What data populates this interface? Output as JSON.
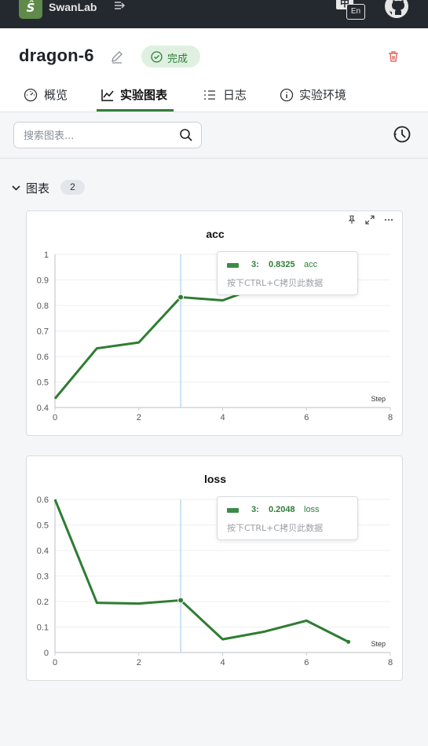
{
  "topbar": {
    "logo_glyph": "Ŝ",
    "brand": "SwanLab",
    "lang_zh": "中",
    "lang_en": "En"
  },
  "header": {
    "title": "dragon-6",
    "status": "完成",
    "tabs": [
      {
        "label": "概览",
        "icon": "gauge-icon"
      },
      {
        "label": "实验图表",
        "icon": "line-chart-icon",
        "active": true
      },
      {
        "label": "日志",
        "icon": "list-icon"
      },
      {
        "label": "实验环境",
        "icon": "info-icon"
      }
    ]
  },
  "search": {
    "placeholder": "搜索图表...",
    "value": ""
  },
  "group": {
    "title": "图表",
    "count": "2"
  },
  "tooltip_hint": "按下CTRL+C拷贝此数据",
  "colors": {
    "accent": "#2f7d3a",
    "line": "#2e7d32",
    "status_bg": "#dff0e1"
  },
  "chart_data": [
    {
      "type": "line",
      "title": "acc",
      "xlabel": "Step",
      "xlim": [
        0,
        8
      ],
      "ylim": [
        0.4,
        1
      ],
      "xticks": [
        "0",
        "2",
        "4",
        "6",
        "8"
      ],
      "yticks": [
        "0.4",
        "0.5",
        "0.6",
        "0.7",
        "0.8",
        "0.9",
        "1"
      ],
      "series": [
        {
          "name": "acc",
          "x": [
            0,
            1,
            2,
            3,
            4,
            5,
            6,
            7
          ],
          "y": [
            0.435,
            0.632,
            0.655,
            0.8325,
            0.82,
            0.88,
            0.9,
            0.93
          ]
        }
      ],
      "hover": {
        "step": "3:",
        "value": "0.8325",
        "name": "acc",
        "index": 3
      }
    },
    {
      "type": "line",
      "title": "loss",
      "xlabel": "Step",
      "xlim": [
        0,
        8
      ],
      "ylim": [
        0,
        0.6
      ],
      "xticks": [
        "0",
        "2",
        "4",
        "6",
        "8"
      ],
      "yticks": [
        "0",
        "0.1",
        "0.2",
        "0.3",
        "0.4",
        "0.5",
        "0.6"
      ],
      "series": [
        {
          "name": "loss",
          "x": [
            0,
            1,
            2,
            3,
            4,
            5,
            6,
            7
          ],
          "y": [
            0.6,
            0.195,
            0.192,
            0.2048,
            0.052,
            0.082,
            0.125,
            0.042
          ]
        }
      ],
      "hover": {
        "step": "3:",
        "value": "0.2048",
        "name": "loss",
        "index": 3
      }
    }
  ]
}
